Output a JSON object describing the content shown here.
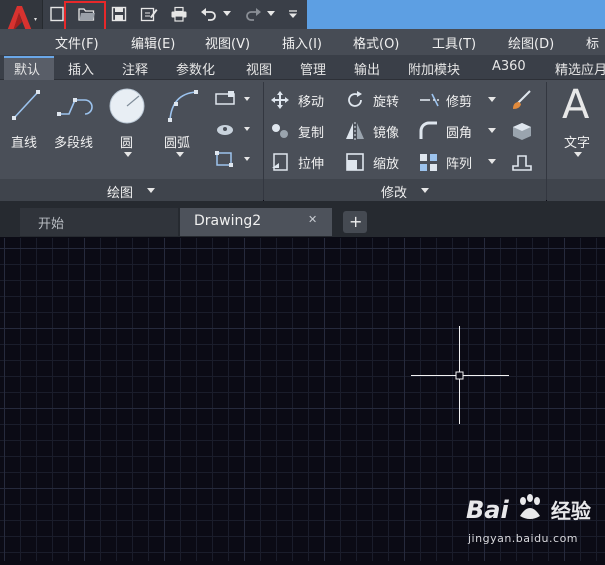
{
  "quick_access": {
    "icons": [
      "autocad-logo-icon",
      "new-file-icon",
      "open-folder-icon",
      "save-icon",
      "save-as-icon",
      "print-icon",
      "undo-icon",
      "redo-icon",
      "customize-icon"
    ]
  },
  "menu": [
    "文件(F)",
    "编辑(E)",
    "视图(V)",
    "插入(I)",
    "格式(O)",
    "工具(T)",
    "绘图(D)",
    "标"
  ],
  "ribbon_tabs": [
    "默认",
    "插入",
    "注释",
    "参数化",
    "视图",
    "管理",
    "输出",
    "附加模块",
    "A360",
    "精选应月"
  ],
  "draw_panel": {
    "tools": [
      "直线",
      "多段线",
      "圆",
      "圆弧"
    ],
    "title": "绘图"
  },
  "modify_panel": {
    "tools": [
      "移动",
      "旋转",
      "修剪",
      "复制",
      "镜像",
      "圆角",
      "拉伸",
      "缩放",
      "阵列"
    ],
    "title": "修改"
  },
  "annotation_panel": {
    "icon_letter": "A",
    "label": "文字"
  },
  "doc_tabs": [
    {
      "label": "开始"
    },
    {
      "label": "Drawing2"
    }
  ],
  "doc_tab_add": "+",
  "doc_tab_close": "✕",
  "watermark": {
    "brand": "Bai",
    "brand_tail": "经验",
    "url": "jingyan.baidu.com"
  },
  "colors": {
    "accent_blue": "#5d9fe3",
    "highlight_red": "#e8282a",
    "canvas_bg": "#0b0b15",
    "grid": "#1c1f2e"
  }
}
